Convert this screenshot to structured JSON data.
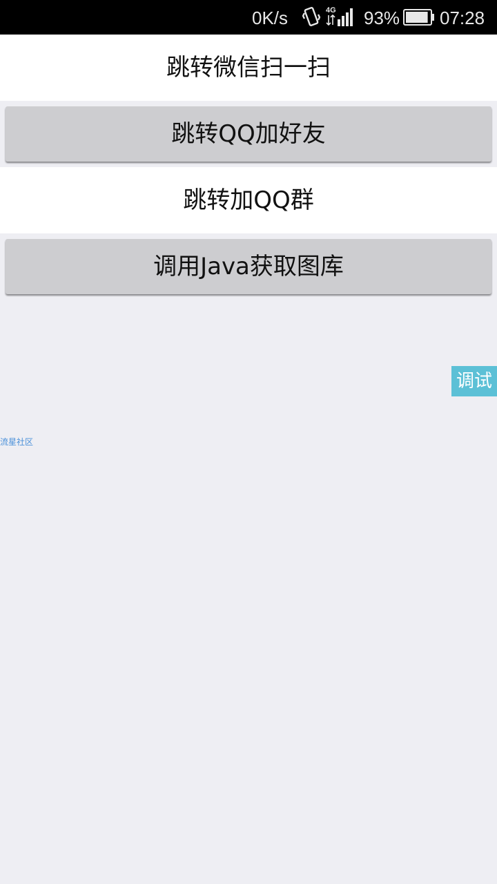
{
  "status_bar": {
    "speed": "0K/s",
    "vibrate_icon": "vibrate-icon",
    "network": "4G",
    "signal_icon": "signal-icon",
    "battery_percent": "93%",
    "battery_icon": "battery-icon",
    "battery_level": 0.93,
    "time": "07:28"
  },
  "main": {
    "wechat_scan_label": "跳转微信扫一扫",
    "qq_add_friend_label": "跳转QQ加好友",
    "qq_join_group_label": "跳转加QQ群",
    "java_gallery_label": "调用Java获取图库"
  },
  "overlay": {
    "debug_label": "调试",
    "watermark": "流星社区"
  },
  "colors": {
    "background": "#eeeef3",
    "button": "#cdcdd0",
    "debug_button": "#5cc0d6",
    "watermark": "#4a90d9"
  }
}
